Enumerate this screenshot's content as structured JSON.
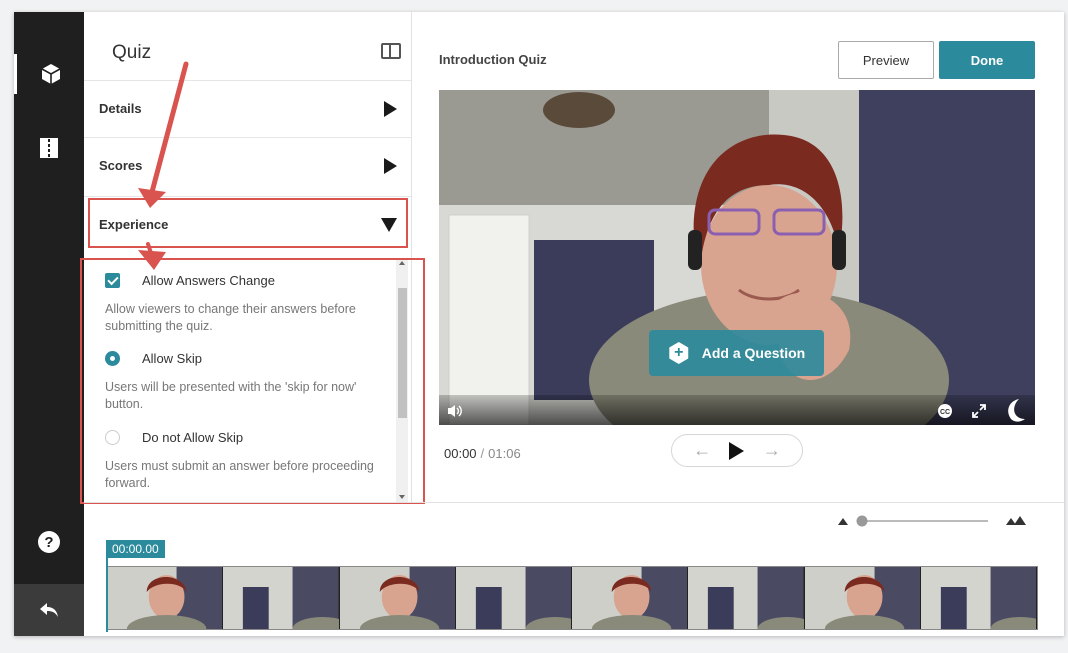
{
  "rail": {
    "icons": [
      "cube-icon",
      "book-icon",
      "help-icon",
      "back-icon"
    ]
  },
  "panel": {
    "title": "Quiz",
    "sections": [
      {
        "label": "Details",
        "state": "collapsed"
      },
      {
        "label": "Scores",
        "state": "collapsed"
      },
      {
        "label": "Experience",
        "state": "expanded"
      }
    ],
    "options": [
      {
        "label": "Allow Answers Change",
        "control": "checkbox",
        "checked": true,
        "description": "Allow viewers to change their answers before submitting the quiz."
      },
      {
        "label": "Allow Skip",
        "control": "radio",
        "checked": true,
        "description": "Users will be presented with the 'skip for now' button."
      },
      {
        "label": "Do not Allow Skip",
        "control": "radio",
        "checked": false,
        "description": "Users must submit an answer before proceeding forward."
      }
    ]
  },
  "main": {
    "title": "Introduction Quiz",
    "preview_label": "Preview",
    "done_label": "Done",
    "add_question_label": "Add a Question",
    "current_time": "00:00",
    "separator": "/",
    "duration": "01:06",
    "timeline_code": "00:00.00"
  },
  "colors": {
    "accent": "#2b8a9c",
    "highlight": "#d9534f",
    "rail": "#1f1f1f"
  }
}
